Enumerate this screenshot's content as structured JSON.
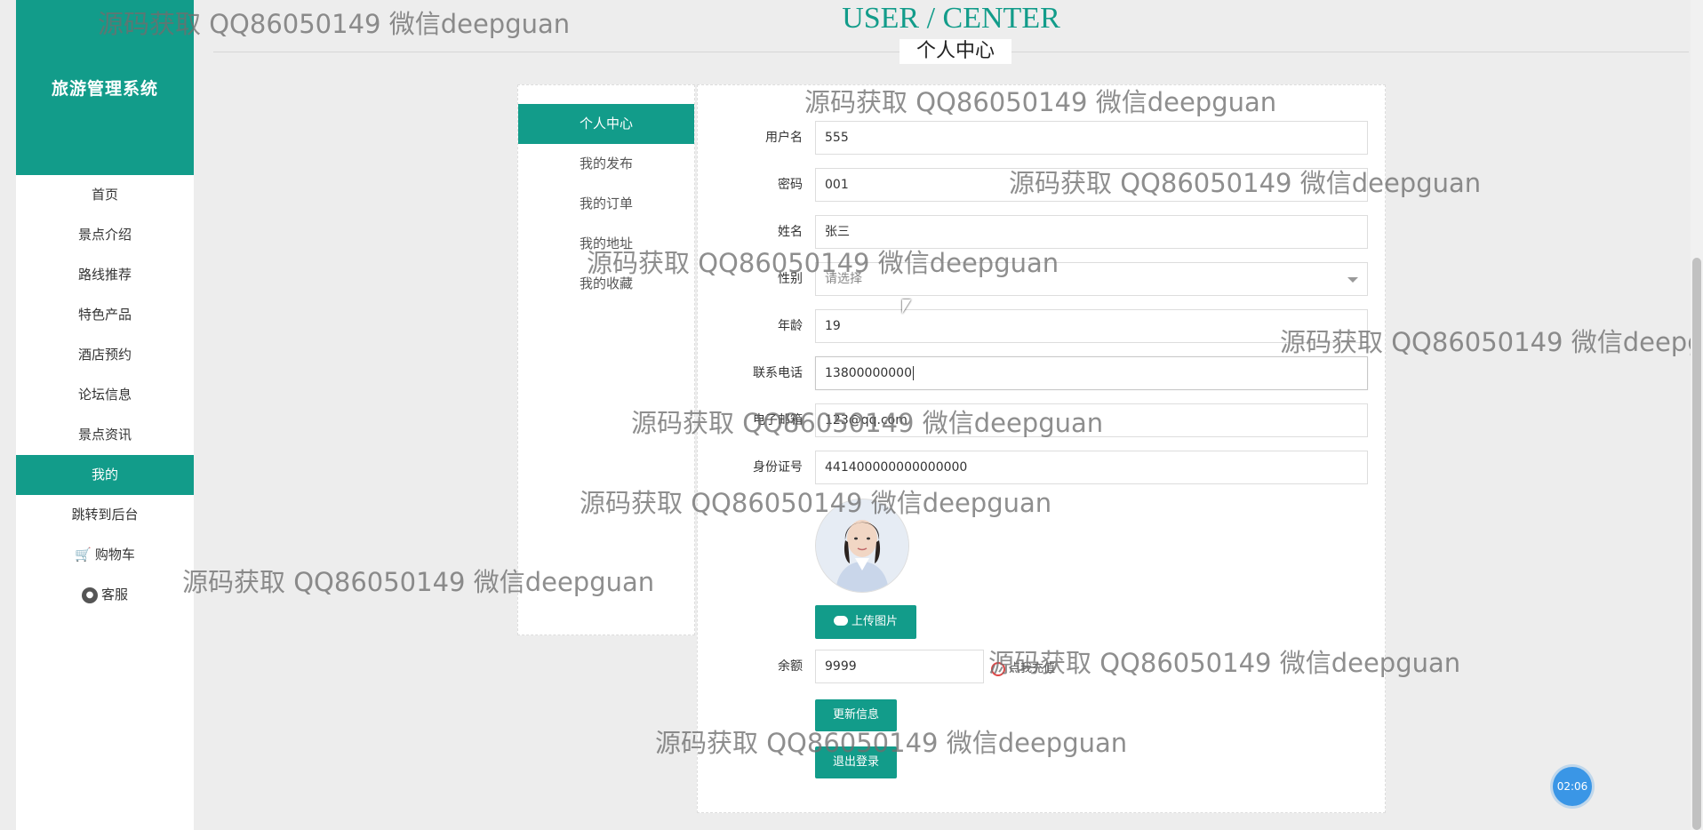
{
  "sidebar": {
    "logo": "旅游管理系统",
    "items": [
      {
        "label": "首页"
      },
      {
        "label": "景点介绍"
      },
      {
        "label": "路线推荐"
      },
      {
        "label": "特色产品"
      },
      {
        "label": "酒店预约"
      },
      {
        "label": "论坛信息"
      },
      {
        "label": "景点资讯"
      },
      {
        "label": "我的"
      },
      {
        "label": "跳转到后台"
      },
      {
        "label": "购物车",
        "icon": "cart-icon"
      },
      {
        "label": "客服",
        "icon": "wechat-icon"
      }
    ],
    "active_index": 7
  },
  "header": {
    "title_en": "USER / CENTER",
    "title_cn": "个人中心"
  },
  "profile_menu": {
    "items": [
      {
        "label": "个人中心"
      },
      {
        "label": "我的发布"
      },
      {
        "label": "我的订单"
      },
      {
        "label": "我的地址"
      },
      {
        "label": "我的收藏"
      }
    ],
    "active_index": 0
  },
  "form": {
    "username": {
      "label": "用户名",
      "value": "555"
    },
    "password": {
      "label": "密码",
      "value": "001"
    },
    "name": {
      "label": "姓名",
      "value": "张三"
    },
    "gender": {
      "label": "性别",
      "placeholder": "请选择"
    },
    "age": {
      "label": "年龄",
      "value": "19"
    },
    "phone": {
      "label": "联系电话",
      "value": "13800000000"
    },
    "email": {
      "label": "电子邮箱",
      "value": "123@qq.com"
    },
    "id_card": {
      "label": "身份证号",
      "value": "441400000000000000"
    },
    "upload_label": "上传图片",
    "balance": {
      "label": "余额",
      "value": "9999"
    },
    "recharge_label": "点我充值",
    "update_label": "更新信息",
    "logout_label": "退出登录"
  },
  "watermark": "源码获取 QQ86050149 微信deepguan",
  "timer": "02:06",
  "colors": {
    "primary": "#129c8a",
    "background": "#ededed"
  }
}
